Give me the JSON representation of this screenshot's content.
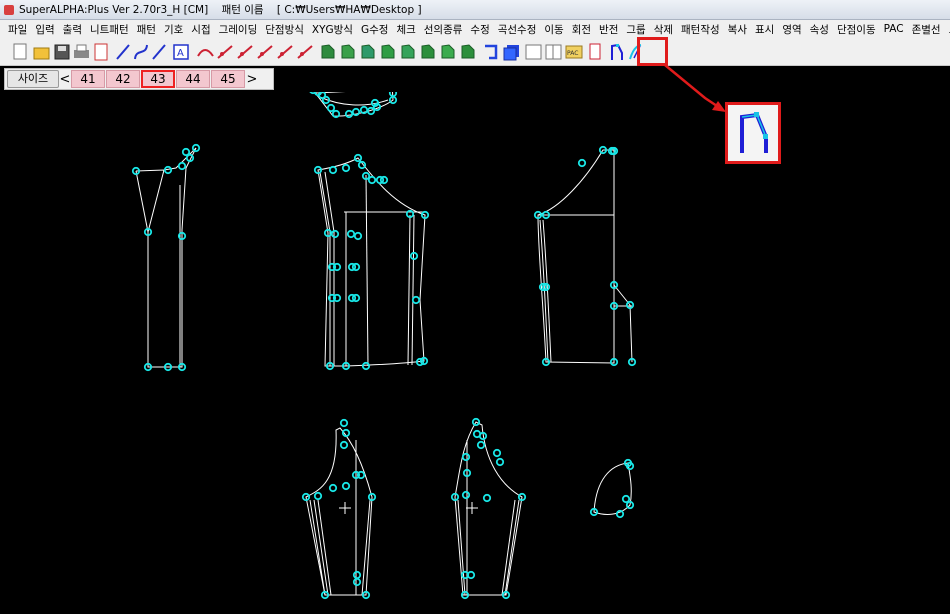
{
  "window": {
    "title_app": "SuperALPHA:Plus Ver 2.70r3_H [CM]",
    "title_pattern": "패턴 이름",
    "title_path": "[ C:₩Users₩HA₩Desktop ]"
  },
  "menu": [
    "파일",
    "입력",
    "출력",
    "니트패턴",
    "패턴",
    "기호",
    "시접",
    "그레이딩",
    "단점방식",
    "XYG방식",
    "G수정",
    "체크",
    "선의종류",
    "수정",
    "곡선수정",
    "이동",
    "회전",
    "반전",
    "그룹",
    "삭제",
    "패턴작성",
    "복사",
    "표시",
    "영역",
    "속성",
    "단점이동",
    "PAC",
    "존별선",
    "도움말"
  ],
  "toolbar": {
    "icons": [
      "new-file-icon",
      "open-folder-icon",
      "save-icon",
      "print-icon",
      "sheet-icon",
      "line-icon",
      "curve-icon",
      "slash-line-icon",
      "text-box-icon",
      "arc-icon",
      "dart-icon",
      "pen-icon",
      "scissors-icon",
      "pin-icon",
      "measure-icon",
      "pattern-green-1-icon",
      "pattern-green-2-icon",
      "pattern-green-3-icon",
      "pattern-green-4-icon",
      "pattern-green-5-icon",
      "pattern-green-6-icon",
      "pattern-green-7-icon",
      "pattern-green-8-icon",
      "fold-blue-icon",
      "stack-blue-icon",
      "white-sheet-icon",
      "grid-sheet-icon",
      "pac-icon",
      "doc-red-icon",
      "pattern-draft-icon",
      "curve-pen-icon"
    ],
    "pac_label": "PAC",
    "highlighted_tool": "pattern-draft-icon"
  },
  "size_bar": {
    "label": "사이즈",
    "prev": "<",
    "next": ">",
    "sizes": [
      "41",
      "42",
      "43",
      "44",
      "45"
    ],
    "active_size": "43"
  },
  "colors": {
    "canvas_bg": "#000000",
    "pattern_line": "#ffffff",
    "point_marker": "#19e6e6",
    "highlight": "#e01b1b",
    "size_cell_bg": "#f3c7cf"
  }
}
